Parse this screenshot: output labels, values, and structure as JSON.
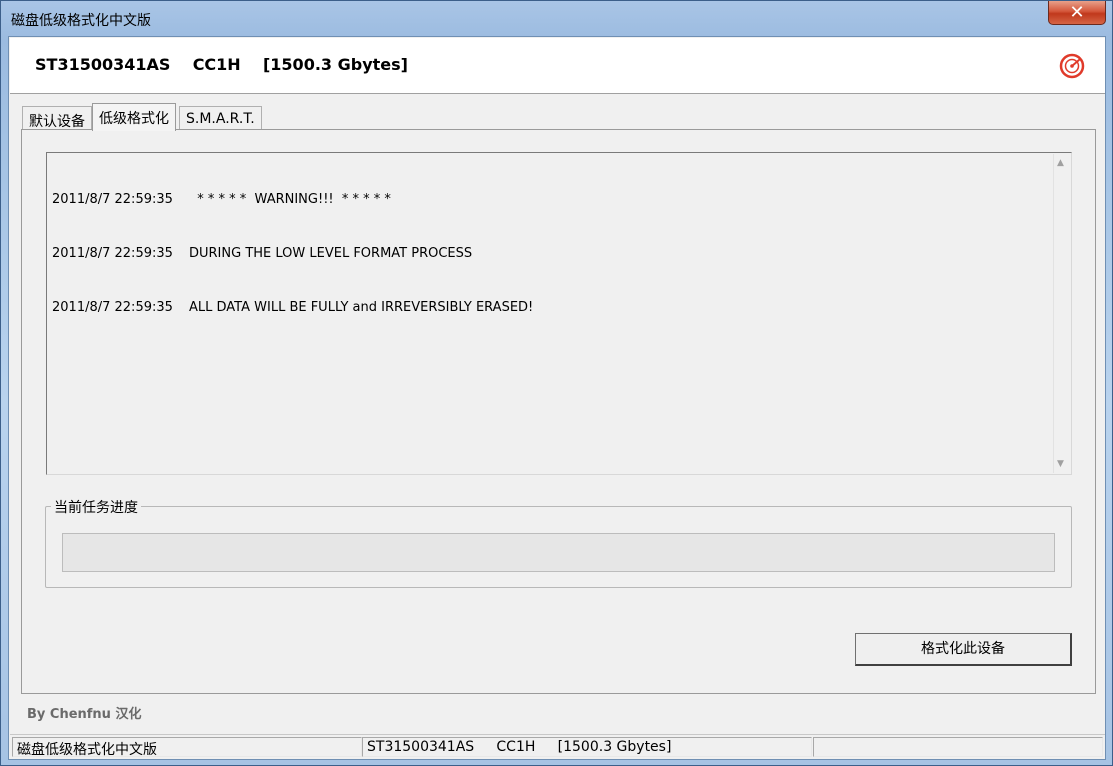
{
  "window": {
    "title": "磁盘低级格式化中文版",
    "close_glyph": "✕"
  },
  "header": {
    "device_title": "ST31500341AS    CC1H    [1500.3 Gbytes]",
    "logo_icon": "app-logo-icon"
  },
  "tabs": [
    {
      "label": "默认设备",
      "active": false
    },
    {
      "label": "低级格式化",
      "active": true
    },
    {
      "label": "S.M.A.R.T.",
      "active": false
    }
  ],
  "log": {
    "lines": [
      {
        "time": "2011/8/7 22:59:35",
        "message": "  * * * * *  WARNING!!!  * * * * *"
      },
      {
        "time": "2011/8/7 22:59:35",
        "message": "DURING THE LOW LEVEL FORMAT PROCESS"
      },
      {
        "time": "2011/8/7 22:59:35",
        "message": "ALL DATA WILL BE FULLY and IRREVERSIBLY ERASED!"
      }
    ]
  },
  "progress": {
    "label": "当前任务进度",
    "value": 0
  },
  "format_button": {
    "label": "格式化此设备"
  },
  "credit": "By Chenfnu 汉化",
  "statusbar": {
    "pane1": "磁盘低级格式化中文版",
    "pane2": "ST31500341AS     CC1H     [1500.3 Gbytes]",
    "pane3": ""
  },
  "colors": {
    "accent": "#d4573b",
    "progress": "#37b531"
  }
}
